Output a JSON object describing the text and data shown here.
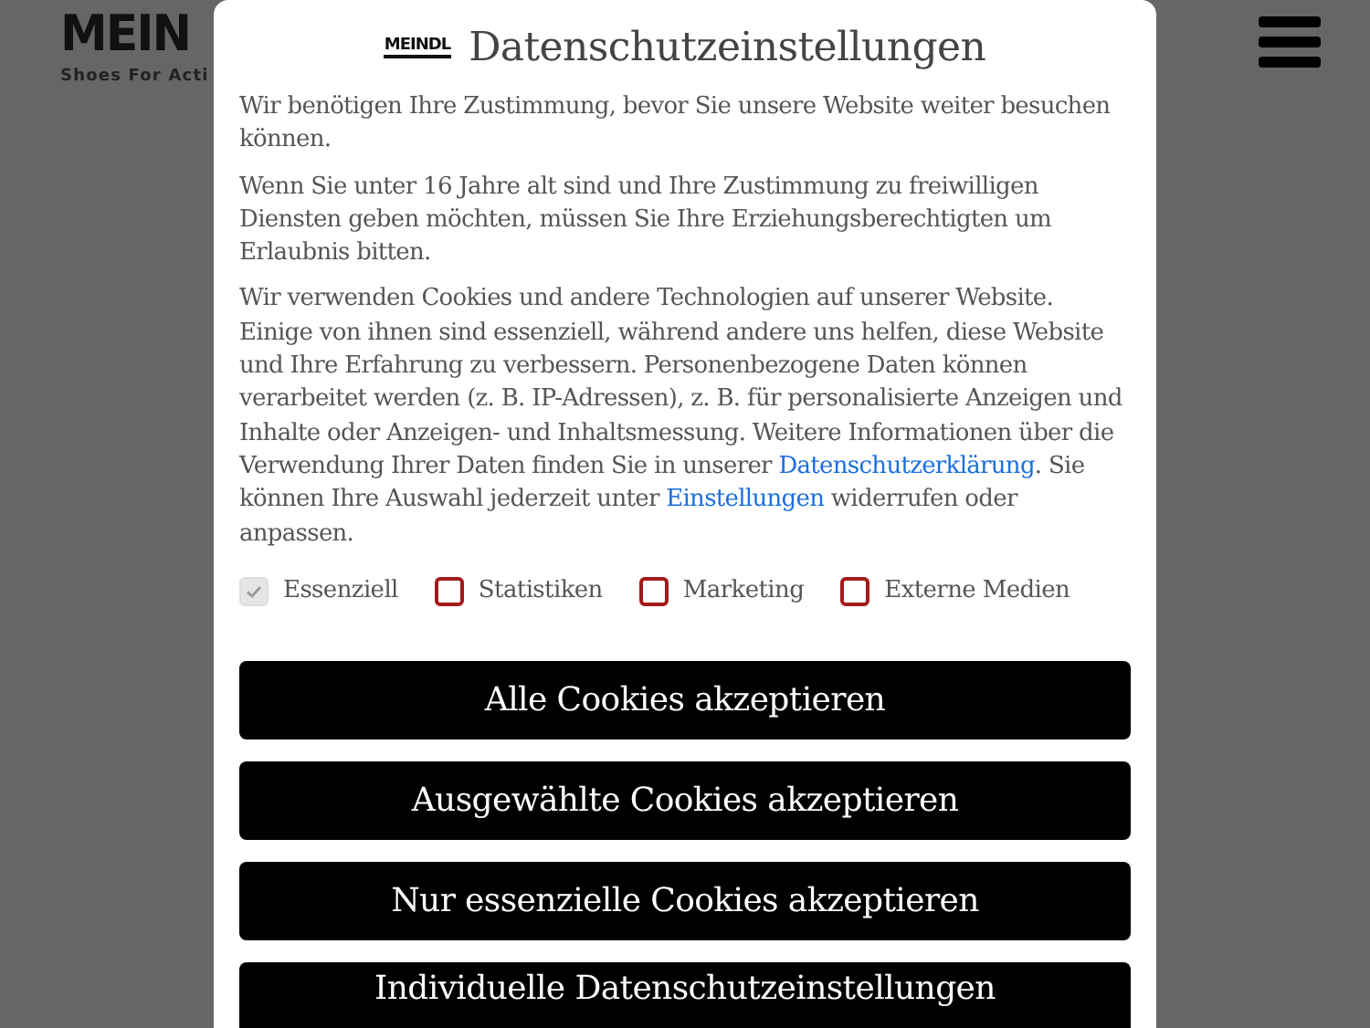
{
  "page_header": {
    "logo": "MEIN",
    "tagline": "Shoes For Acti"
  },
  "dialog": {
    "logo": "MEINDL",
    "title": "Datenschutzeinstellungen",
    "paragraphs": [
      [
        {
          "kind": "text",
          "text": "Wir benötigen Ihre Zustimmung, bevor Sie unsere Website weiter besuchen können."
        }
      ],
      [
        {
          "kind": "text",
          "text": "Wenn Sie unter 16 Jahre alt sind und Ihre Zustimmung zu freiwilligen Diensten geben möchten, müssen Sie Ihre Erziehungsberechtigten um Erlaubnis bitten."
        }
      ],
      [
        {
          "kind": "text",
          "text": "Wir verwenden Cookies und andere Technologien auf unserer Website. Einige von ihnen sind essenziell, während andere uns helfen, diese Website und Ihre Erfahrung zu verbessern. Personenbezogene Daten können verarbeitet werden (z. B. IP-Adressen), z. B. für personalisierte Anzeigen und Inhalte oder Anzeigen- und Inhaltsmessung. Weitere Informationen über die Verwendung Ihrer Daten finden Sie in unserer "
        },
        {
          "kind": "link",
          "text": "Datenschutzerklärung"
        },
        {
          "kind": "text",
          "text": ". Sie können Ihre Auswahl jederzeit unter "
        },
        {
          "kind": "link",
          "text": "Einstellungen"
        },
        {
          "kind": "text",
          "text": " widerrufen oder anpassen."
        }
      ]
    ],
    "categories": [
      {
        "label": "Essenziell",
        "checked": true,
        "disabled": true
      },
      {
        "label": "Statistiken",
        "checked": false,
        "disabled": false
      },
      {
        "label": "Marketing",
        "checked": false,
        "disabled": false
      },
      {
        "label": "Externe Medien",
        "checked": false,
        "disabled": false
      }
    ],
    "buttons": [
      "Alle Cookies akzeptieren",
      "Ausgewählte Cookies akzeptieren",
      "Nur essenzielle Cookies akzeptieren",
      "Individuelle Datenschutzeinstellungen"
    ]
  }
}
